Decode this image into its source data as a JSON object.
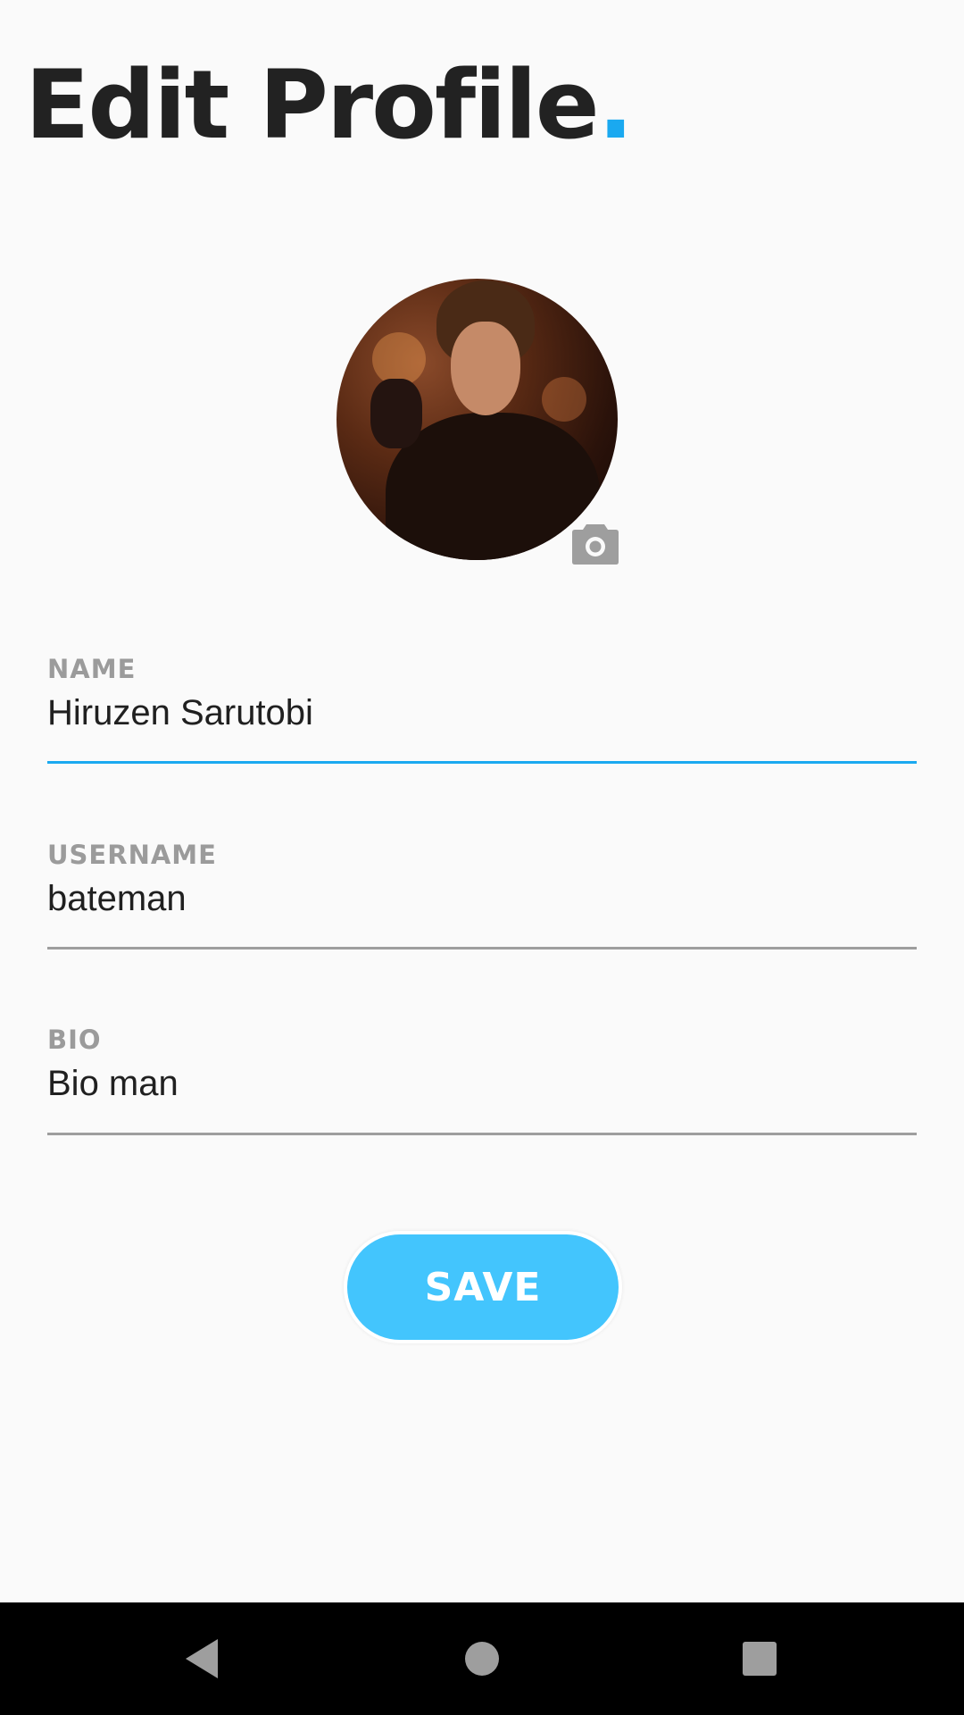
{
  "header": {
    "title": "Edit Profile",
    "title_dot": ".",
    "accent_color": "#1aa9f0"
  },
  "avatar": {
    "icon": "camera-icon"
  },
  "form": {
    "fields": [
      {
        "label": "NAME",
        "value": "Hiruzen Sarutobi",
        "focused": true
      },
      {
        "label": "USERNAME",
        "value": "bateman",
        "focused": false
      },
      {
        "label": "BIO",
        "value": "Bio man",
        "focused": false
      }
    ]
  },
  "actions": {
    "save_label": "SAVE",
    "save_color": "#43c5fd"
  },
  "navbar": {
    "back_icon": "back-triangle-icon",
    "home_icon": "home-circle-icon",
    "recents_icon": "recents-square-icon"
  }
}
